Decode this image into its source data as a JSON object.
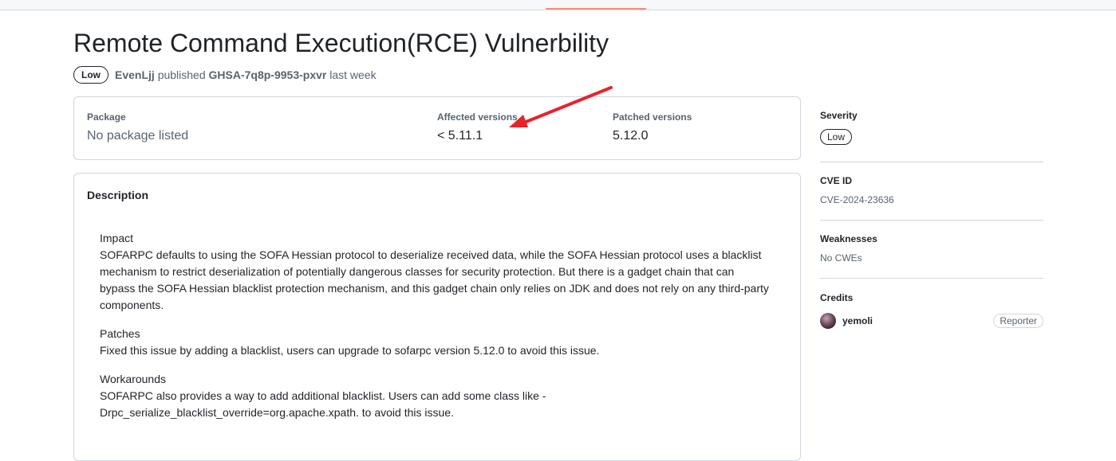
{
  "advisory": {
    "title": "Remote Command Execution(RCE) Vulnerbility",
    "severity_badge": "Low",
    "author": "EvenLjj",
    "action": "published",
    "ghsa_id": "GHSA-7q8p-9953-pxvr",
    "when": "last week"
  },
  "package_box": {
    "package_label": "Package",
    "package_value": "No package listed",
    "affected_label": "Affected versions",
    "affected_value": "< 5.11.1",
    "patched_label": "Patched versions",
    "patched_value": "5.12.0"
  },
  "description": {
    "heading": "Description",
    "sections": [
      {
        "title": "Impact",
        "body": "SOFARPC defaults to using the SOFA Hessian protocol to deserialize received data, while the SOFA Hessian protocol uses a blacklist mechanism to restrict deserialization of potentially dangerous classes for security protection. But there is a gadget chain that can bypass the SOFA Hessian blacklist protection mechanism, and this gadget chain only relies on JDK and does not rely on any third-party components."
      },
      {
        "title": "Patches",
        "body": "Fixed this issue by adding a blacklist, users can upgrade to sofarpc version 5.12.0 to avoid this issue."
      },
      {
        "title": "Workarounds",
        "body": "SOFARPC also provides a way to add additional blacklist. Users can add some class like -Drpc_serialize_blacklist_override=org.apache.xpath. to avoid this issue."
      }
    ]
  },
  "sidebar": {
    "severity_label": "Severity",
    "severity_value": "Low",
    "cve_label": "CVE ID",
    "cve_value": "CVE-2024-23636",
    "weaknesses_label": "Weaknesses",
    "weaknesses_value": "No CWEs",
    "credits_label": "Credits",
    "credit_user": "yemoli",
    "credit_role": "Reporter"
  },
  "colors": {
    "annotation_arrow": "#e8232a",
    "tab_underline": "#fd8c73"
  }
}
